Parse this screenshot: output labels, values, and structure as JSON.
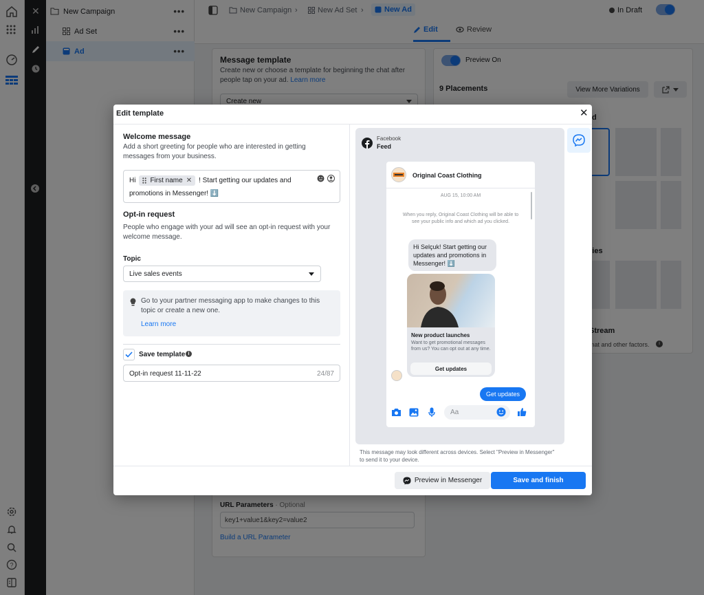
{
  "sidebar_tree": {
    "items": [
      {
        "label": "New Campaign",
        "icon": "folder-icon"
      },
      {
        "label": "Ad Set",
        "icon": "grid-icon"
      },
      {
        "label": "Ad",
        "icon": "ad-icon"
      }
    ],
    "more": "•••"
  },
  "topbar": {
    "breadcrumbs": [
      "New Campaign",
      "New Ad Set",
      "New Ad"
    ],
    "status": "In Draft",
    "tabs": [
      "Edit",
      "Review"
    ]
  },
  "background_left": {
    "message_template_title": "Message template",
    "message_template_desc": "Create new or choose a template for beginning the chat after people tap on your ad.",
    "learn_more": "Learn more",
    "template_select": "Create new",
    "url_params_title": "URL Parameters",
    "url_params_optional": "· Optional",
    "url_params_value": "key1+value1&key2=value2",
    "build_url": "Build a URL Parameter"
  },
  "background_right": {
    "preview_toggle": "Preview On",
    "placements": "9 Placements",
    "view_more": "View More Variations",
    "partial_1": "d",
    "partial_2": "ries",
    "partial_3": "Stream",
    "partial_4": "mat and other factors."
  },
  "modal": {
    "title": "Edit template",
    "welcome": {
      "title": "Welcome message",
      "desc": "Add a short greeting for people who are interested in getting messages from your business.",
      "prefix": "Hi",
      "chip": "First name",
      "suffix": "! Start getting our updates and",
      "line2": "promotions in Messenger! ⬇️"
    },
    "optin": {
      "title": "Opt-in request",
      "desc": "People who engage with your ad will see an opt-in request with your welcome message."
    },
    "topic": {
      "label": "Topic",
      "value": "Live sales events"
    },
    "info_box": {
      "text": "Go to your partner messaging app to make changes to this topic or create a new one.",
      "link": "Learn more"
    },
    "save_template": {
      "label": "Save template",
      "name_value": "Opt-in request 11-11-22",
      "counter": "24/87"
    },
    "preview": {
      "platform": "Facebook",
      "placement": "Feed",
      "business": "Original Coast Clothing",
      "date": "AUG 15, 10:00 AM",
      "notice": "When you reply, Original Coast Clothing will be able to see your public info and which ad you clicked.",
      "greeting": "Hi Selçuk! Start getting our updates and promotions in Messenger! ⬇️",
      "card_title": "New product launches",
      "card_desc": "Want to get promotional messages from us? You can opt out at any time.",
      "card_button": "Get updates",
      "user_reply": "Get updates",
      "composer_placeholder": "Aa",
      "disclaimer": "This message may look different across devices. Select \"Preview in Messenger\" to send it to your device."
    },
    "buttons": {
      "preview_messenger": "Preview in Messenger",
      "save_finish": "Save and finish"
    }
  },
  "colors": {
    "accent": "#1877f2",
    "messenger": "#0084ff"
  }
}
